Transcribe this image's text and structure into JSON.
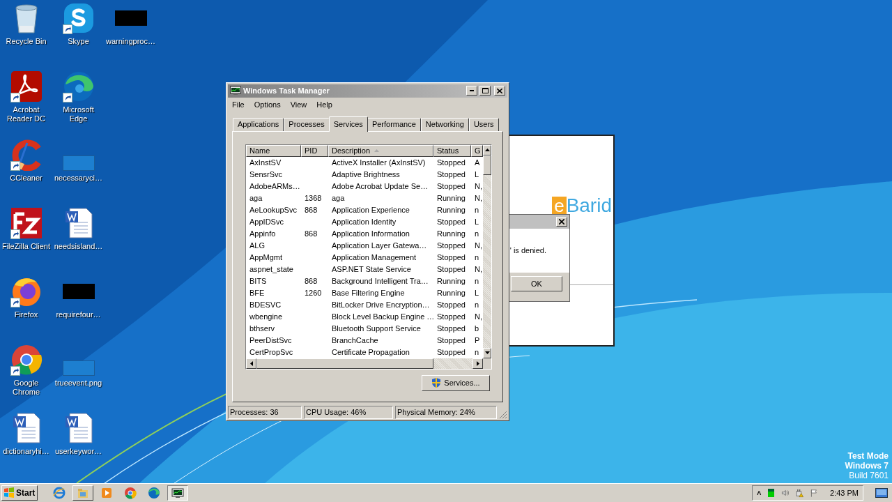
{
  "desktop": {
    "rows": [
      [
        {
          "label": "Recycle Bin",
          "kind": "recycle",
          "shortcut": false
        },
        {
          "label": "Skype",
          "kind": "skype",
          "shortcut": true
        },
        {
          "label": "warningproc…",
          "kind": "black-thumb",
          "shortcut": false
        }
      ],
      [
        {
          "label": "Acrobat Reader DC",
          "kind": "acrobat",
          "shortcut": true
        },
        {
          "label": "Microsoft Edge",
          "kind": "edge",
          "shortcut": true
        }
      ],
      [
        {
          "label": "CCleaner",
          "kind": "ccleaner",
          "shortcut": true
        },
        {
          "label": "necessaryci…",
          "kind": "blank-thumb",
          "shortcut": false
        }
      ],
      [
        {
          "label": "FileZilla Client",
          "kind": "filezilla",
          "shortcut": true
        },
        {
          "label": "needsisland…",
          "kind": "word",
          "shortcut": false
        }
      ],
      [
        {
          "label": "Firefox",
          "kind": "firefox",
          "shortcut": true
        },
        {
          "label": "requirefour…",
          "kind": "black-thumb",
          "shortcut": false
        }
      ],
      [
        {
          "label": "Google Chrome",
          "kind": "chrome",
          "shortcut": true
        },
        {
          "label": "trueevent.png",
          "kind": "blank-thumb",
          "shortcut": false
        }
      ],
      [
        {
          "label": "dictionaryhi…",
          "kind": "word",
          "shortcut": false
        },
        {
          "label": "userkeywor…",
          "kind": "word",
          "shortcut": false
        }
      ]
    ]
  },
  "background_window": {
    "logo_mark": "e",
    "logo_text": "Barid"
  },
  "dialog": {
    "message": "' is denied.",
    "button": "OK"
  },
  "task_manager": {
    "title": "Windows Task Manager",
    "menu": [
      "File",
      "Options",
      "View",
      "Help"
    ],
    "tabs": [
      {
        "label": "Applications",
        "selected": false
      },
      {
        "label": "Processes",
        "selected": false
      },
      {
        "label": "Services",
        "selected": true
      },
      {
        "label": "Performance",
        "selected": false
      },
      {
        "label": "Networking",
        "selected": false
      },
      {
        "label": "Users",
        "selected": false
      }
    ],
    "columns": [
      {
        "label": "Name",
        "sorted": false
      },
      {
        "label": "PID",
        "sorted": false
      },
      {
        "label": "Description",
        "sorted": true
      },
      {
        "label": "Status",
        "sorted": false
      },
      {
        "label": "G",
        "sorted": false
      }
    ],
    "rows": [
      [
        "AxInstSV",
        "",
        "ActiveX Installer (AxInstSV)",
        "Stopped",
        "A"
      ],
      [
        "SensrSvc",
        "",
        "Adaptive Brightness",
        "Stopped",
        "L"
      ],
      [
        "AdobeARMs…",
        "",
        "Adobe Acrobat Update Se…",
        "Stopped",
        "N,"
      ],
      [
        "aga",
        "1368",
        "aga",
        "Running",
        "N,"
      ],
      [
        "AeLookupSvc",
        "868",
        "Application Experience",
        "Running",
        "n"
      ],
      [
        "AppIDSvc",
        "",
        "Application Identity",
        "Stopped",
        "L"
      ],
      [
        "Appinfo",
        "868",
        "Application Information",
        "Running",
        "n"
      ],
      [
        "ALG",
        "",
        "Application Layer Gatewa…",
        "Stopped",
        "N,"
      ],
      [
        "AppMgmt",
        "",
        "Application Management",
        "Stopped",
        "n"
      ],
      [
        "aspnet_state",
        "",
        "ASP.NET State Service",
        "Stopped",
        "N,"
      ],
      [
        "BITS",
        "868",
        "Background Intelligent Tra…",
        "Running",
        "n"
      ],
      [
        "BFE",
        "1260",
        "Base Filtering Engine",
        "Running",
        "L"
      ],
      [
        "BDESVC",
        "",
        "BitLocker Drive Encryption…",
        "Stopped",
        "n"
      ],
      [
        "wbengine",
        "",
        "Block Level Backup Engine …",
        "Stopped",
        "N,"
      ],
      [
        "bthserv",
        "",
        "Bluetooth Support Service",
        "Stopped",
        "b"
      ],
      [
        "PeerDistSvc",
        "",
        "BranchCache",
        "Stopped",
        "P"
      ],
      [
        "CertPropSvc",
        "",
        "Certificate Propagation",
        "Stopped",
        "n"
      ]
    ],
    "services_button": "Services...",
    "status_bar": [
      "Processes: 36",
      "CPU Usage: 46%",
      "Physical Memory: 24%"
    ]
  },
  "os_notice": {
    "line_1": "Test Mode",
    "line_2": "Windows 7",
    "line_3": "Build 7601"
  },
  "taskbar": {
    "start": "Start",
    "items": [
      {
        "kind": "ie",
        "open": false,
        "selected": false
      },
      {
        "kind": "explorer",
        "open": true,
        "selected": false
      },
      {
        "kind": "media",
        "open": false,
        "selected": false
      },
      {
        "kind": "chrome",
        "open": false,
        "selected": false
      },
      {
        "kind": "edge",
        "open": false,
        "selected": false
      },
      {
        "kind": "taskmgr",
        "open": true,
        "selected": true
      }
    ],
    "tray": {
      "chevron": "˄",
      "clock": "2:43 PM"
    }
  }
}
